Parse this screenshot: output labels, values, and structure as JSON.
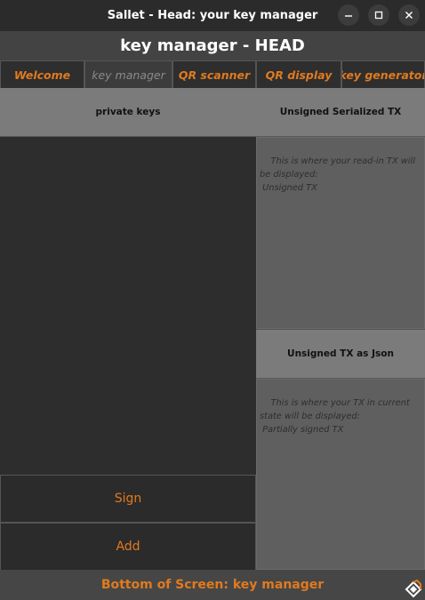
{
  "window": {
    "title": "Sallet - Head: your key manager",
    "controls": [
      "minimize-icon",
      "maximize-icon",
      "close-icon"
    ]
  },
  "header": {
    "title": "key manager - HEAD"
  },
  "tabs": [
    {
      "label": "Welcome",
      "active": false
    },
    {
      "label": "key manager",
      "active": true
    },
    {
      "label": "QR scanner",
      "active": false
    },
    {
      "label": "QR display",
      "active": false
    },
    {
      "label": "key generator",
      "active": false
    }
  ],
  "left": {
    "header": "private keys",
    "buttons": {
      "sign": "Sign",
      "add": "Add"
    }
  },
  "right": {
    "unsigned_header": "Unsigned Serialized TX",
    "unsigned_text": "This is where your read-in TX will be displayed:\n Unsigned TX",
    "json_header": "Unsigned TX as Json",
    "json_text": "This is where your TX in current state will be displayed:\n Partially signed TX"
  },
  "footer": {
    "text": "Bottom of Screen: key manager"
  },
  "colors": {
    "accent": "#e07a1f",
    "background": "#2d2d2d",
    "section_header": "#7b7b7b",
    "text_area": "#5f5f5f"
  }
}
